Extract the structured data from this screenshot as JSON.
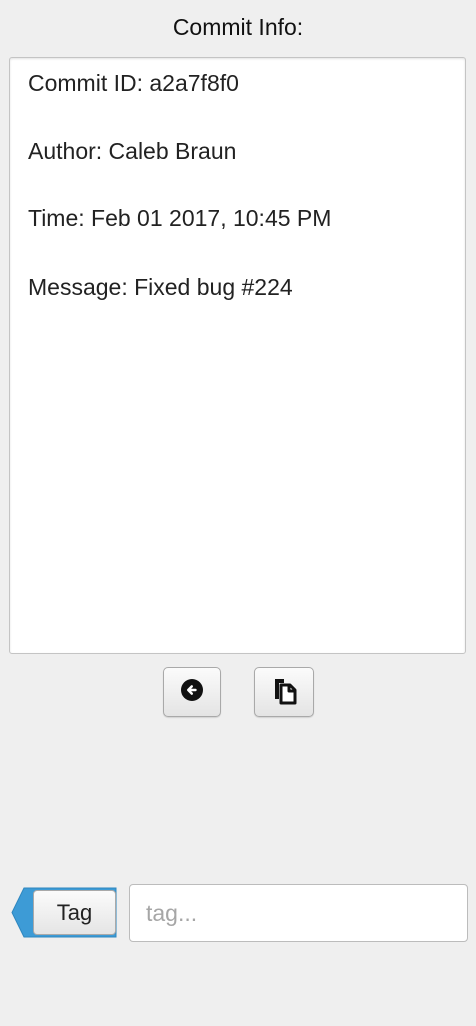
{
  "header": {
    "title": "Commit Info:"
  },
  "commit": {
    "id_line": "Commit ID: a2a7f8f0",
    "author_line": "Author: Caleb Braun",
    "time_line": "Time: Feb 01 2017, 10:45 PM",
    "message_line": "Message: Fixed bug #224"
  },
  "actions": {
    "back_icon": "arrow-left-circle-icon",
    "copy_icon": "clipboard-copy-icon"
  },
  "tag": {
    "button_label": "Tag",
    "input_value": "",
    "input_placeholder": "tag..."
  },
  "colors": {
    "background": "#efefef",
    "tag_accent": "#3d9bd6"
  }
}
